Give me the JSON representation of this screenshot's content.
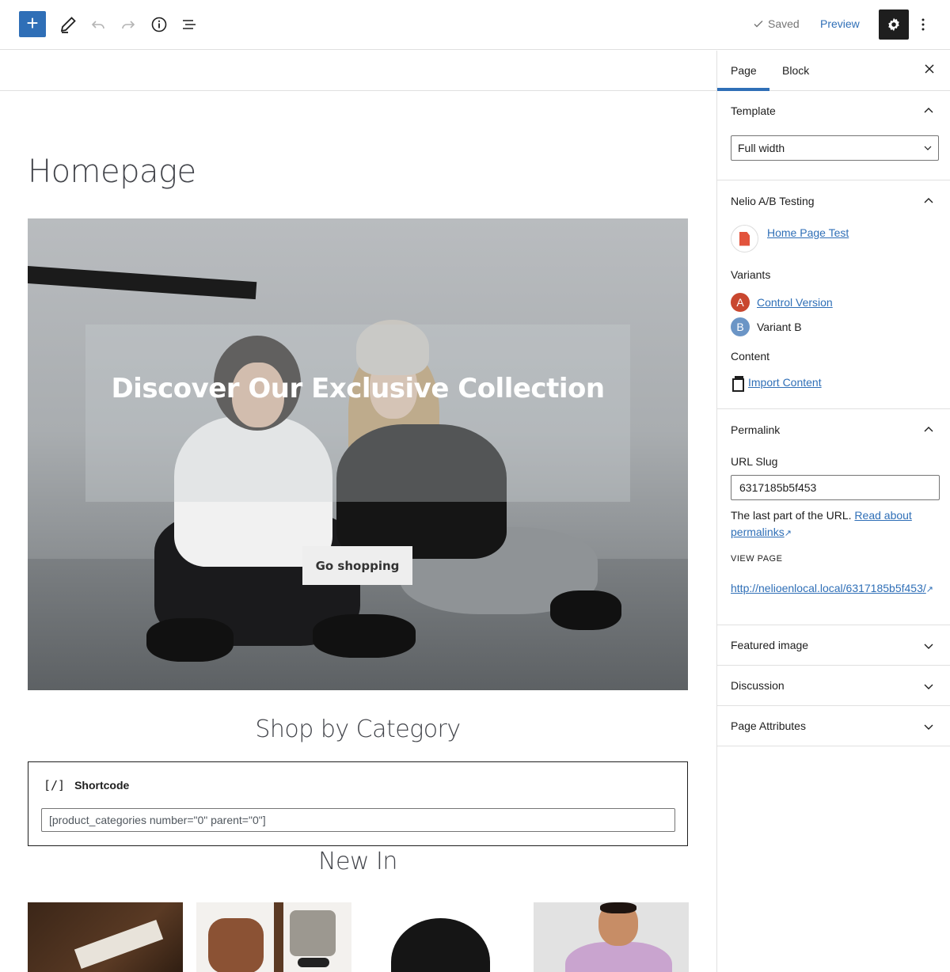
{
  "toolbar": {
    "add_icon": "plus-icon",
    "saved_label": "Saved",
    "preview_label": "Preview"
  },
  "editor": {
    "page_title": "Homepage",
    "hero": {
      "heading": "Discover Our Exclusive Collection",
      "button_label": "Go shopping"
    },
    "shop_title": "Shop by Category",
    "shortcode": {
      "block_label": "Shortcode",
      "icon_text": "[/]",
      "value": "[product_categories number=\"0\" parent=\"0\"]"
    },
    "new_in_title": "New In"
  },
  "sidebar": {
    "tabs": [
      "Page",
      "Block"
    ],
    "template": {
      "title": "Template",
      "selected": "Full width"
    },
    "ab_testing": {
      "title": "Nelio A/B Testing",
      "test_link": "Home Page Test",
      "variants_label": "Variants",
      "variants": [
        {
          "letter": "A",
          "label": "Control Version"
        },
        {
          "letter": "B",
          "label": "Variant B"
        }
      ],
      "content_label": "Content",
      "import_label": "Import Content"
    },
    "permalink": {
      "title": "Permalink",
      "slug_label": "URL Slug",
      "slug_value": "6317185b5f453",
      "help_text": "The last part of the URL.",
      "help_link_1": "Read about",
      "help_link_2": "permalinks",
      "view_page_label": "VIEW PAGE",
      "url": "http://nelioenlocal.local/6317185b5f453/"
    },
    "collapsed_panels": [
      "Featured image",
      "Discussion",
      "Page Attributes"
    ]
  },
  "colors": {
    "accent": "#2f6fb7",
    "variant_a": "#c9472f",
    "variant_b": "#6b95c6"
  }
}
